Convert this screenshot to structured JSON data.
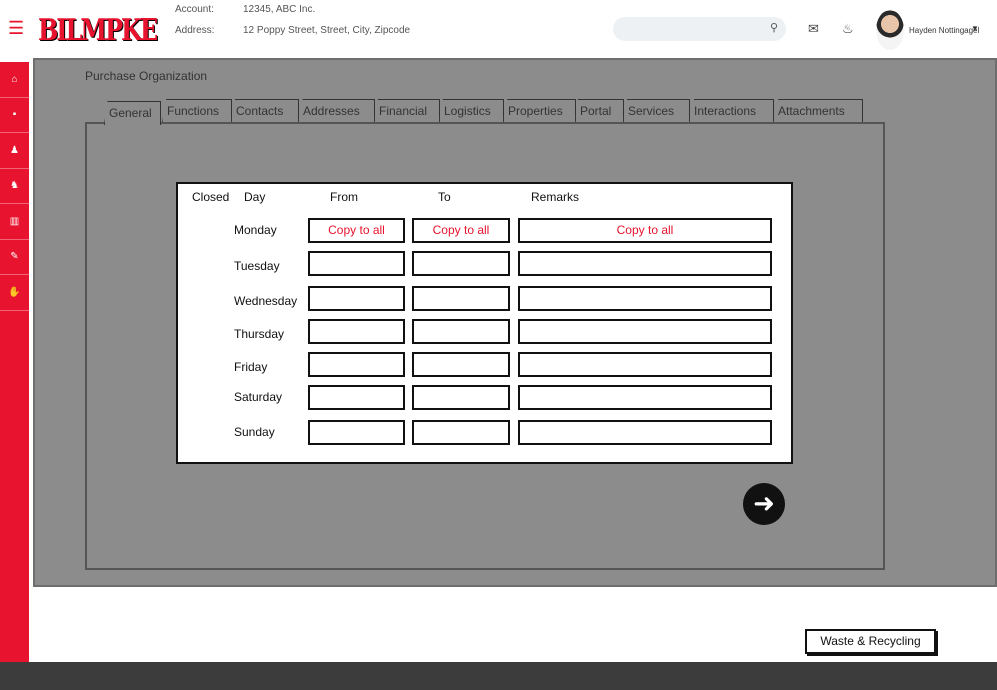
{
  "header": {
    "logo_text": "BILMPKE",
    "account_label": "Account:",
    "account_value": "12345, ABC Inc.",
    "address_label": "Address:",
    "address_value": "12 Poppy Street, Street, City, Zipcode",
    "search_placeholder": "",
    "username": "Hayden Nottingagel",
    "icons": [
      "menu-icon",
      "search-icon",
      "mail-icon",
      "bell-icon",
      "chevron-down-icon"
    ]
  },
  "sidebar": {
    "items": [
      {
        "name": "home",
        "glyph": "⌂"
      },
      {
        "name": "document",
        "glyph": "▪"
      },
      {
        "name": "user",
        "glyph": "♟"
      },
      {
        "name": "users",
        "glyph": "♞"
      },
      {
        "name": "chart",
        "glyph": "▥"
      },
      {
        "name": "tools",
        "glyph": "✎"
      },
      {
        "name": "thumbs-up",
        "glyph": "✋"
      }
    ]
  },
  "main": {
    "title": "Purchase Organization",
    "tabs": [
      "General",
      "Functions",
      "Contacts",
      "Addresses",
      "Financial",
      "Logistics",
      "Properties",
      "Portal",
      "Services",
      "Interactions",
      "Attachments"
    ],
    "active_tab": "General",
    "hours": {
      "headers": {
        "closed": "Closed",
        "day": "Day",
        "from": "From",
        "to": "To",
        "remarks": "Remarks"
      },
      "days": [
        {
          "day": "Monday",
          "from": "Copy to all",
          "to": "Copy to all",
          "remarks": "Copy to all"
        },
        {
          "day": "Tuesday",
          "from": "",
          "to": "",
          "remarks": ""
        },
        {
          "day": "Wednesday",
          "from": "",
          "to": "",
          "remarks": ""
        },
        {
          "day": "Thursday",
          "from": "",
          "to": "",
          "remarks": ""
        },
        {
          "day": "Friday",
          "from": "",
          "to": "",
          "remarks": ""
        },
        {
          "day": "Saturday",
          "from": "",
          "to": "",
          "remarks": ""
        },
        {
          "day": "Sunday",
          "from": "",
          "to": "",
          "remarks": ""
        }
      ]
    }
  },
  "waste_button_label": "Waste & Recycling",
  "colors": {
    "brand": "#e8132e",
    "panel": "#8c8c8c",
    "footer": "#3c3c3c",
    "accent_text": "#e8132e"
  }
}
